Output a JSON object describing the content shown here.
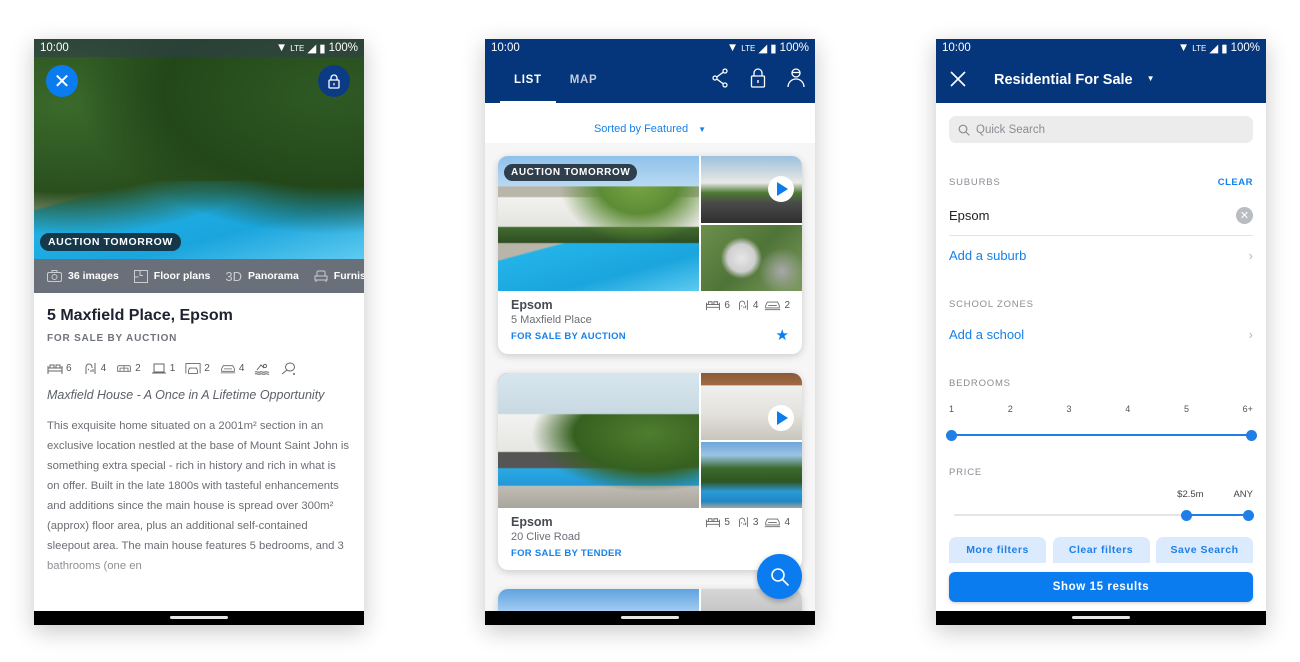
{
  "status_bar": {
    "time": "10:00",
    "network": "LTE",
    "battery": "100%"
  },
  "listing_detail": {
    "badge": "AUCTION TOMORROW",
    "media": [
      {
        "icon": "camera-icon",
        "label": "36 images"
      },
      {
        "icon": "floorplan-icon",
        "label": "Floor plans"
      },
      {
        "icon": "3d-icon",
        "glyph": "3D",
        "label": "Panorama"
      },
      {
        "icon": "armchair-icon",
        "label": "Furnis"
      }
    ],
    "title": "5 Maxfield Place, Epsom",
    "sale_method": "FOR SALE BY AUCTION",
    "features": [
      {
        "icon": "bed-icon",
        "value": "6"
      },
      {
        "icon": "shower-icon",
        "value": "4"
      },
      {
        "icon": "sofa-icon",
        "value": "2"
      },
      {
        "icon": "laptop-icon",
        "value": "1"
      },
      {
        "icon": "garage-icon",
        "value": "2"
      },
      {
        "icon": "car-icon",
        "value": "4"
      },
      {
        "icon": "swimmer-icon",
        "value": ""
      },
      {
        "icon": "tennis-racket-icon",
        "value": ""
      }
    ],
    "headline": "Maxfield House - A Once in A Lifetime Opportunity",
    "description": "This exquisite home situated on a 2001m² section in an exclusive location nestled at the base of Mount Saint John is something extra special - rich in history and rich in what is on offer. Built in the late 1800s with tasteful enhancements and additions since the main house is spread over 300m² (approx) floor area, plus an additional self-contained sleepout area. The main house features 5 bedrooms, and 3 bathrooms (one en"
  },
  "listing_list": {
    "tabs": [
      {
        "label": "LIST",
        "active": true
      },
      {
        "label": "MAP",
        "active": false
      }
    ],
    "sort_label": "Sorted by Featured",
    "cards": [
      {
        "badge": "AUCTION TOMORROW",
        "suburb": "Epsom",
        "address": "5 Maxfield Place",
        "sale_method": "FOR SALE BY AUCTION",
        "beds": "6",
        "baths": "4",
        "cars": "2",
        "favorited": true
      },
      {
        "badge": "",
        "suburb": "Epsom",
        "address": "20 Clive Road",
        "sale_method": "FOR SALE BY TENDER",
        "beds": "5",
        "baths": "3",
        "cars": "4",
        "favorited": false
      }
    ]
  },
  "filters": {
    "title": "Residential For Sale",
    "search_placeholder": "Quick Search",
    "suburbs_label": "SUBURBS",
    "clear_label": "CLEAR",
    "selected_suburb": "Epsom",
    "add_suburb": "Add a suburb",
    "school_zones_label": "SCHOOL ZONES",
    "add_school": "Add a school",
    "bedrooms_label": "BEDROOMS",
    "bedroom_ticks": [
      "1",
      "2",
      "3",
      "4",
      "5",
      "6+"
    ],
    "bedrooms_range": {
      "min_index": 0,
      "max_index": 5
    },
    "price_label": "PRICE",
    "price_min_label": "$2.5m",
    "price_max_label": "ANY",
    "price_range_fraction": {
      "min": 0.79,
      "max": 1.0
    },
    "buttons": [
      "More filters",
      "Clear filters",
      "Save Search"
    ],
    "show_results": "Show 15 results"
  }
}
